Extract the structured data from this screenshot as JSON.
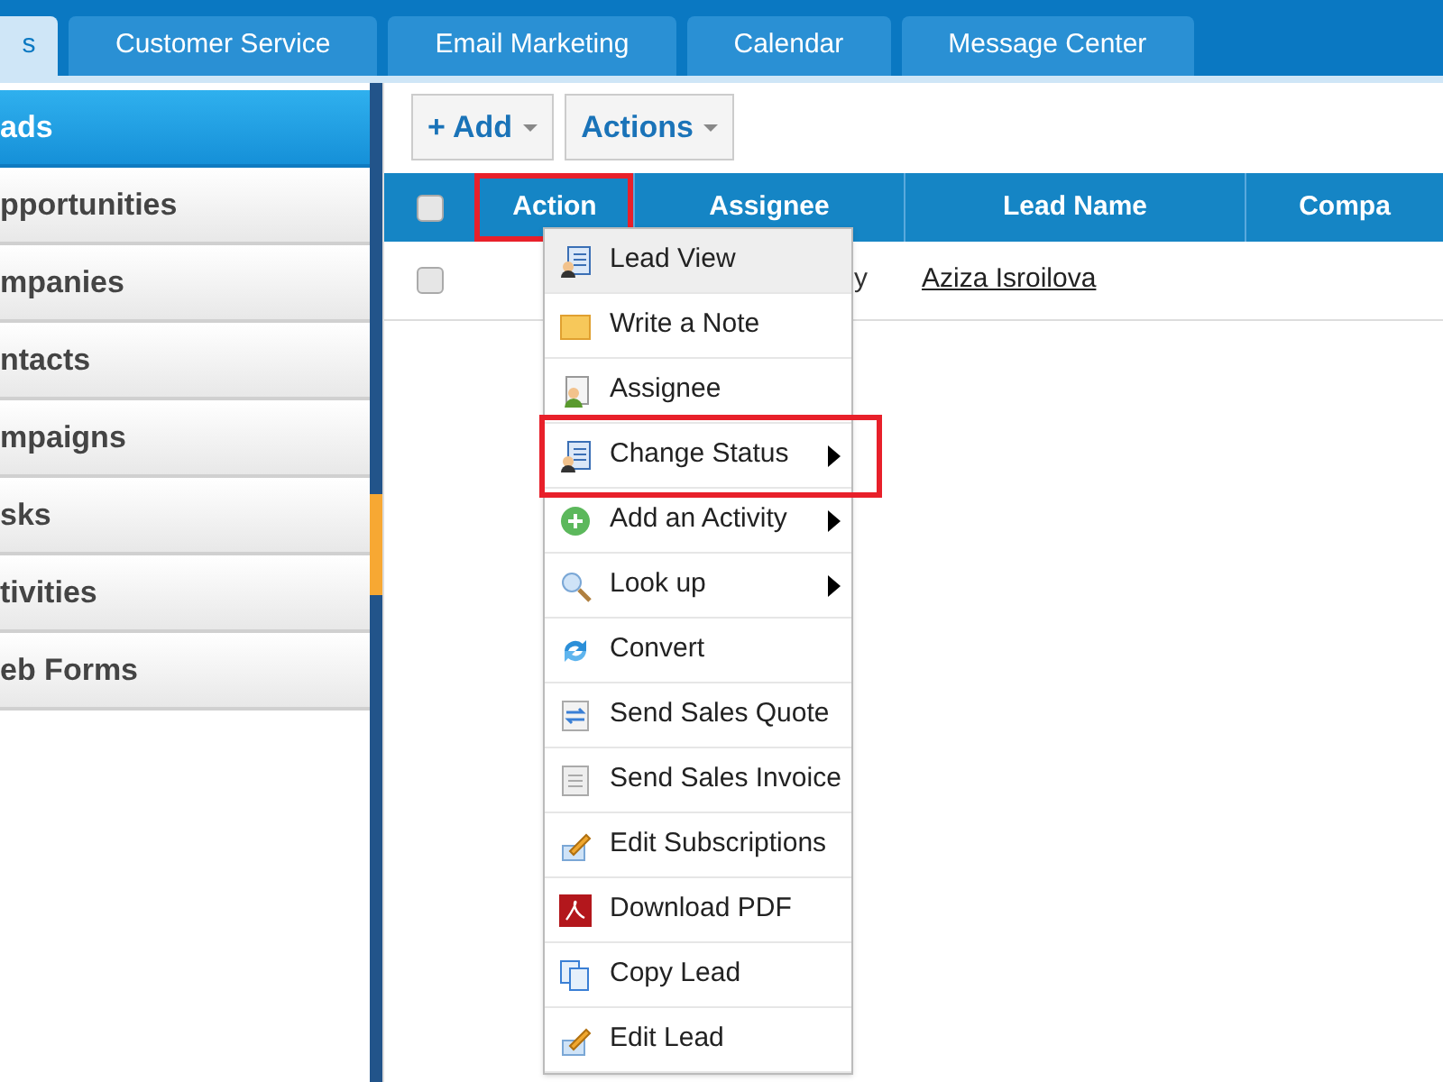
{
  "tabs": [
    {
      "label": "s",
      "selected": true
    },
    {
      "label": "Customer Service",
      "selected": false
    },
    {
      "label": "Email Marketing",
      "selected": false
    },
    {
      "label": "Calendar",
      "selected": false
    },
    {
      "label": "Message Center",
      "selected": false
    }
  ],
  "sidebar": {
    "items": [
      {
        "label": "ads",
        "selected": true
      },
      {
        "label": "pportunities",
        "selected": false
      },
      {
        "label": "mpanies",
        "selected": false
      },
      {
        "label": "ntacts",
        "selected": false
      },
      {
        "label": "mpaigns",
        "selected": false
      },
      {
        "label": "sks",
        "selected": false
      },
      {
        "label": "tivities",
        "selected": false
      },
      {
        "label": "eb Forms",
        "selected": false
      }
    ]
  },
  "toolbar": {
    "buttons": [
      "+ Add",
      "Actions"
    ]
  },
  "table": {
    "columns": [
      {
        "label": "Action",
        "highlighted": true
      },
      {
        "label": "Assignee",
        "highlighted": false
      },
      {
        "label": "Lead Name",
        "highlighted": false
      },
      {
        "label": "Compa",
        "highlighted": false
      }
    ],
    "select_all": {
      "checked": false
    },
    "rows": [
      {
        "checked": false,
        "assignee": "y",
        "lead_name": "Aziza Isroilova"
      }
    ]
  },
  "menu": {
    "items": [
      {
        "label": "Lead View",
        "kind": "person-doc",
        "submenu": false,
        "highlighted": false,
        "hovered": true
      },
      {
        "label": "Write a Note",
        "kind": "note",
        "submenu": false,
        "highlighted": false,
        "hovered": false
      },
      {
        "label": "Assignee",
        "kind": "person",
        "submenu": false,
        "highlighted": false,
        "hovered": false
      },
      {
        "label": "Change Status",
        "kind": "person-doc",
        "submenu": true,
        "highlighted": true,
        "hovered": false
      },
      {
        "label": "Add an Activity",
        "kind": "plus",
        "submenu": true,
        "highlighted": false,
        "hovered": false
      },
      {
        "label": "Look up",
        "kind": "search",
        "submenu": true,
        "highlighted": false,
        "hovered": false
      },
      {
        "label": "Convert",
        "kind": "convert",
        "submenu": false,
        "highlighted": false,
        "hovered": false
      },
      {
        "label": "Send Sales Quote",
        "kind": "quote",
        "submenu": false,
        "highlighted": false,
        "hovered": false
      },
      {
        "label": "Send Sales Invoice",
        "kind": "invoice",
        "submenu": false,
        "highlighted": false,
        "hovered": false
      },
      {
        "label": "Edit Subscriptions",
        "kind": "pencil",
        "submenu": false,
        "highlighted": false,
        "hovered": false
      },
      {
        "label": "Download PDF",
        "kind": "pdf",
        "submenu": false,
        "highlighted": false,
        "hovered": false
      },
      {
        "label": "Copy Lead",
        "kind": "copy",
        "submenu": false,
        "highlighted": false,
        "hovered": false
      },
      {
        "label": "Edit Lead",
        "kind": "pencil",
        "submenu": false,
        "highlighted": false,
        "hovered": false
      }
    ]
  }
}
